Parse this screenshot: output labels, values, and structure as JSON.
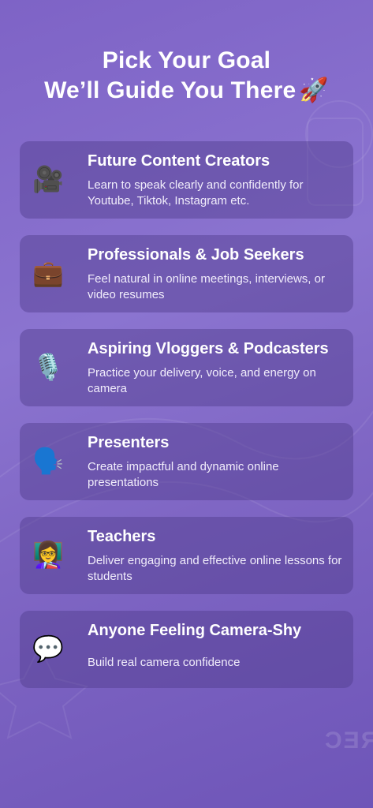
{
  "header": {
    "line1": "Pick Your Goal",
    "line2": "We’ll Guide You There",
    "emoji": "🚀"
  },
  "goals": [
    {
      "icon": "video-camera-icon",
      "emoji": "🎥",
      "title": "Future Content Creators",
      "desc": "Learn to speak clearly and confidently for Youtube, Tiktok, Instagram etc."
    },
    {
      "icon": "briefcase-icon",
      "emoji": "💼",
      "title": "Professionals & Job Seekers",
      "desc": "Feel natural in online meetings, interviews, or video resumes"
    },
    {
      "icon": "microphone-icon",
      "emoji": "🎙️",
      "title": "Aspiring Vloggers & Podcasters",
      "desc": "Practice your delivery, voice, and energy on camera"
    },
    {
      "icon": "speaking-head-icon",
      "emoji": "🗣️",
      "title": "Presenters",
      "desc": "Create impactful and dynamic online presentations"
    },
    {
      "icon": "teacher-icon",
      "emoji": "👩‍🏫",
      "title": "Teachers",
      "desc": "Deliver engaging and effective online lessons for students"
    },
    {
      "icon": "speech-bubble-icon",
      "emoji": "💬",
      "title": "Anyone Feeling Camera-Shy",
      "desc": "Build real camera confidence"
    }
  ],
  "background": {
    "watermark": "REC"
  }
}
